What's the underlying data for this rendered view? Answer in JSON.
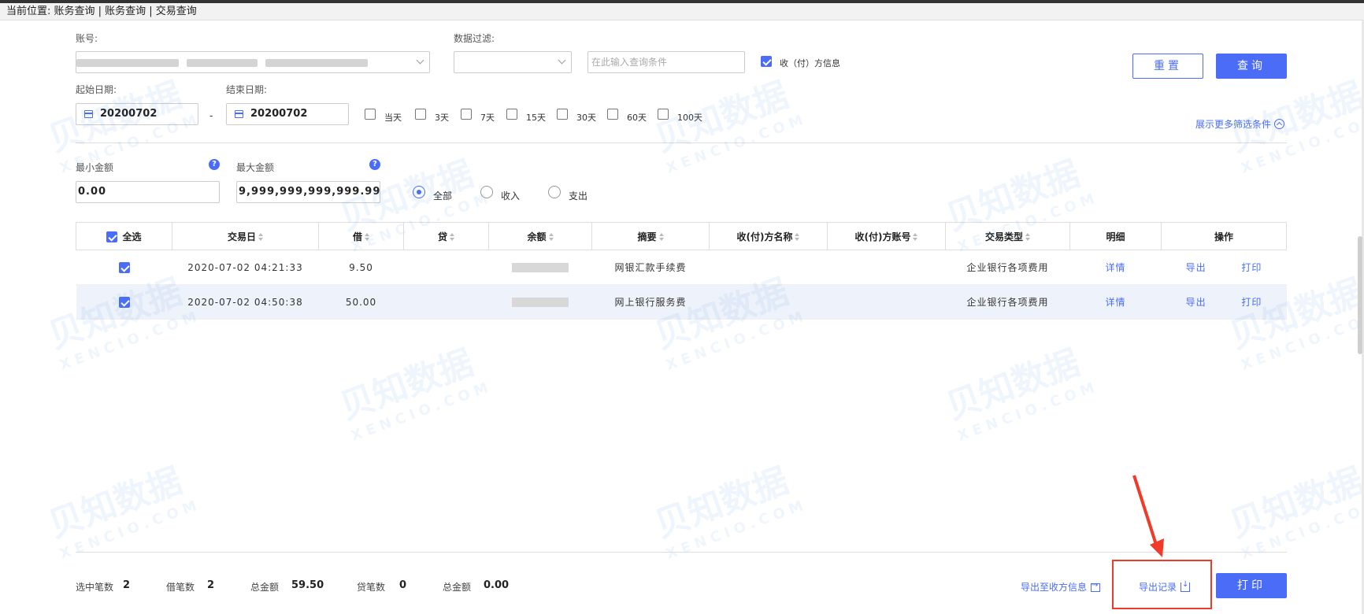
{
  "breadcrumb": "当前位置: 账务查询 | 账务查询 | 交易查询",
  "filters": {
    "account_label": "账号:",
    "data_filter_label": "数据过滤:",
    "query_placeholder": "在此输入查询条件",
    "payee_info_label": "收（付）方信息",
    "payee_info_checked": true,
    "start_date_label": "起始日期:",
    "end_date_label": "结束日期:",
    "start_date": "20200702",
    "end_date": "20200702",
    "date_separator": "-",
    "quick_ranges": [
      "当天",
      "3天",
      "7天",
      "15天",
      "30天",
      "60天",
      "100天"
    ],
    "more_filters": "展示更多筛选条件",
    "min_amount_label": "最小金额",
    "max_amount_label": "最大金额",
    "min_amount": "0.00",
    "max_amount": "9,999,999,999,999.99",
    "help_glyph": "?",
    "direction_options": [
      "全部",
      "收入",
      "支出"
    ],
    "direction_selected": "全部"
  },
  "buttons": {
    "reset": "重置",
    "query": "查询",
    "print": "打印"
  },
  "table": {
    "select_all": "全选",
    "columns": [
      "交易日",
      "借",
      "贷",
      "余额",
      "摘要",
      "收(付)方名称",
      "收(付)方账号",
      "交易类型",
      "明细",
      "操作"
    ],
    "rows": [
      {
        "checked": true,
        "date": "2020-07-02 04:21:33",
        "debit": "9.50",
        "credit": "",
        "summary": "网银汇款手续费",
        "payee_name": "",
        "payee_account": "",
        "type": "企业银行各项费用",
        "detail": "详情",
        "export": "导出",
        "print": "打印"
      },
      {
        "checked": true,
        "date": "2020-07-02 04:50:38",
        "debit": "50.00",
        "credit": "",
        "summary": "网上银行服务费",
        "payee_name": "",
        "payee_account": "",
        "type": "企业银行各项费用",
        "detail": "详情",
        "export": "导出",
        "print": "打印"
      }
    ]
  },
  "footer": {
    "selected_count_label": "选中笔数",
    "selected_count": "2",
    "debit_count_label": "借笔数",
    "debit_count": "2",
    "debit_total_label": "总金额",
    "debit_total": "59.50",
    "credit_count_label": "贷笔数",
    "credit_count": "0",
    "credit_total_label": "总金额",
    "credit_total": "0.00",
    "export_to_payee": "导出至收方信息",
    "export_records": "导出记录"
  },
  "watermark": {
    "brand": "贝知数据",
    "domain": "XENCIO.COM"
  },
  "colors": {
    "accent": "#4a6cf7",
    "highlight": "#f03a2a"
  }
}
